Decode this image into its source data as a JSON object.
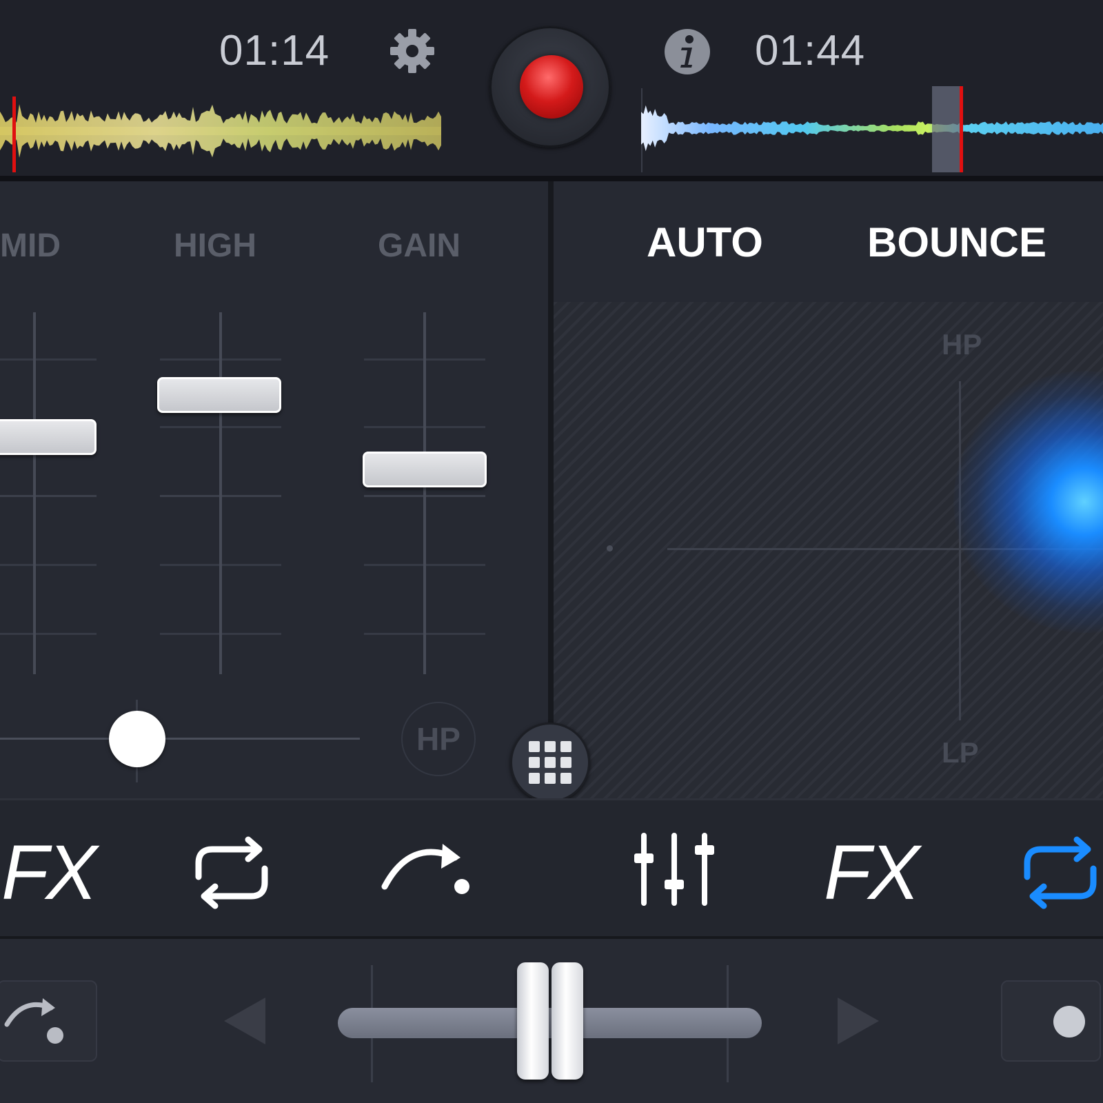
{
  "header": {
    "left_time": "01:14",
    "right_time": "01:44",
    "settings_icon": "gear-icon",
    "info_icon": "info-icon",
    "record_icon": "record-icon"
  },
  "eq": {
    "labels": [
      "MID",
      "HIGH",
      "GAIN"
    ],
    "filter_button_label": "HP"
  },
  "fx_panel": {
    "tabs": [
      "AUTO",
      "BOUNCE"
    ],
    "pad_top_label": "HP",
    "pad_bottom_label": "LP"
  },
  "toolbar": {
    "left": {
      "fx_label": "FX",
      "icons": [
        "loop-icon",
        "jump-icon"
      ]
    },
    "right": {
      "icons": [
        "mixer-icon",
        "loop-icon"
      ],
      "fx_label": "FX"
    },
    "grid_icon": "grid-icon"
  },
  "crossfader": {
    "left_button_icon": "jump-icon",
    "right_button_icon": "dot-icon",
    "position": 0.5
  },
  "colors": {
    "record": "#d41a1a",
    "active_accent": "#1a8cff",
    "playhead": "#e01010"
  }
}
